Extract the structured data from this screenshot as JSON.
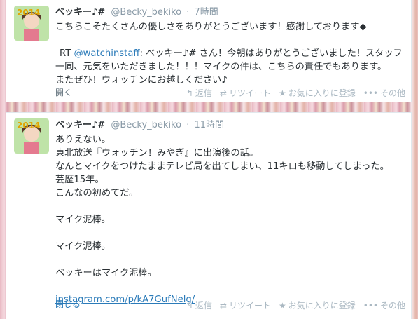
{
  "tweets": [
    {
      "name": "ベッキー♪#",
      "screen_name": "@Becky_bekiko",
      "time": "7時間",
      "lines": [
        "こちらこそたくさんの優しさをありがとうございます！感謝しております◆",
        "",
        "RT ",
        "一同、元気をいただきました！！！マイクの件は、こちらの責任でもあります。",
        "またぜひ！ウォッチンにお越しください♪"
      ],
      "rt_mention": "@watchinstaff",
      "rt_rest": ": ベッキー♪# さん！今朝はありがとうございました！スタッフ",
      "expand": "開く"
    },
    {
      "name": "ベッキー♪#",
      "screen_name": "@Becky_bekiko",
      "time": "11時間",
      "lines": [
        "ありえない。",
        "東北放送『ウォッチン！みやぎ』に出演後の話。",
        "なんとマイクをつけたままテレビ局を出てしまい、11キロも移動してしまった。",
        "芸歴15年。",
        "こんなの初めてだ。",
        "",
        "マイク泥棒。",
        "",
        "マイク泥棒。",
        "",
        "ベッキーはマイク泥棒。",
        ""
      ],
      "link": "instagram.com/p/kA7GufNelg/",
      "expand": "閉じる"
    }
  ],
  "actions": {
    "reply": "返信",
    "retweet": "リツイート",
    "favorite": "お気に入りに登録",
    "more": "その他"
  },
  "icons": {
    "reply": "reply-icon",
    "retweet": "retweet-icon",
    "favorite": "star-icon",
    "more": "more-dots-icon"
  },
  "avatar_text": "2014"
}
